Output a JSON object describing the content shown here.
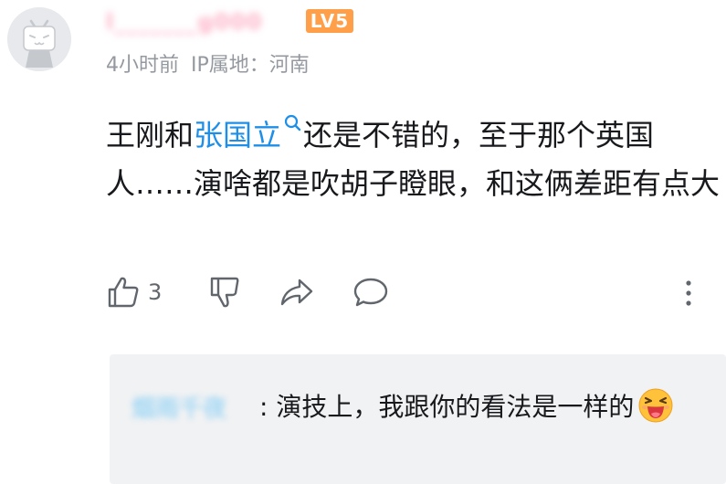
{
  "comment": {
    "username": "l_______g000",
    "level_badge": "LV5",
    "time": "4小时前",
    "ip_location": "IP属地：河南",
    "text_before": "王刚和",
    "link_text": "张国立",
    "text_after": "还是不错的，至于那个英国人……演啥都是吹胡子瞪眼，和这俩差距有点大",
    "like_count": "3"
  },
  "reply": {
    "username": "烟雨千夜",
    "colon": ":",
    "text": "演技上，我跟你的看法是一样的"
  },
  "colors": {
    "username_pink": "#fb7299",
    "level_orange": "#ff9f4a",
    "link_blue": "#1e8fe8",
    "meta_gray": "#9499a0",
    "reply_bg": "#f1f2f3"
  },
  "icons": [
    "tv-avatar-icon",
    "search-icon",
    "thumbs-up-icon",
    "thumbs-down-icon",
    "share-icon",
    "comment-icon",
    "more-vertical-icon",
    "laughing-emoji-icon"
  ]
}
